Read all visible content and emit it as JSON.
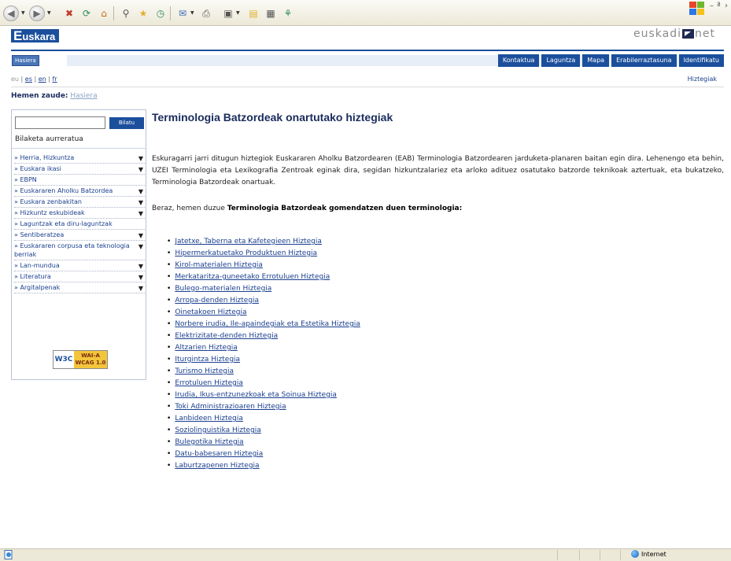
{
  "browser": {
    "toolbar_icons": [
      "back-icon",
      "forward-icon",
      "stop-icon",
      "refresh-icon",
      "home-icon",
      "search-icon",
      "favorites-icon",
      "history-icon",
      "mail-icon",
      "print-icon",
      "edit-icon",
      "discuss-icon",
      "folder-icon",
      "research-icon",
      "messenger-icon"
    ],
    "status_zone": "Internet"
  },
  "header": {
    "logo_initial": "E",
    "logo_text": "uskara",
    "brand_left": "euskadi",
    "brand_right": "net"
  },
  "nav": {
    "home_label": "Hasiera",
    "items": [
      "Kontaktua",
      "Laguntza",
      "Mapa",
      "Erabilerraztasuna",
      "Identifikatu"
    ]
  },
  "lang": {
    "items": [
      "eu",
      "es",
      "en",
      "fr"
    ],
    "separator": "|"
  },
  "hiztegiak_link": "Hiztegiak",
  "breadcrumb": {
    "label": "Hemen zaude:",
    "current": "Hasiera"
  },
  "sidebar": {
    "search_value": "",
    "search_button": "Bilatu",
    "advanced_search": "Bilaketa aurreratua",
    "items": [
      {
        "label": "» Herria, Hizkuntza",
        "has_arrow": true
      },
      {
        "label": "» Euskara ikasi",
        "has_arrow": true
      },
      {
        "label": "» EBPN",
        "has_arrow": false
      },
      {
        "label": "» Euskararen Aholku Batzordea",
        "has_arrow": true
      },
      {
        "label": "» Euskara zenbakitan",
        "has_arrow": true
      },
      {
        "label": "» Hizkuntz eskubideak",
        "has_arrow": true
      },
      {
        "label": "» Laguntzak eta diru-laguntzak",
        "has_arrow": false
      },
      {
        "label": "» Sentiberatzea",
        "has_arrow": true
      },
      {
        "label": "» Euskararen corpusa eta teknologia berriak",
        "has_arrow": true
      },
      {
        "label": "» Lan-mundua",
        "has_arrow": true
      },
      {
        "label": "» Literatura",
        "has_arrow": true
      },
      {
        "label": "» Argitalpenak",
        "has_arrow": true
      }
    ],
    "badge_left": "W3C",
    "badge_right_1": "WAI-A",
    "badge_right_2": "WCAG 1.0"
  },
  "main": {
    "title": "Terminologia Batzordeak onartutako hiztegiak",
    "intro": "Eskuragarri jarri ditugun hiztegiok Euskararen Aholku Batzordearen (EAB) Terminologia Batzordearen jarduketa-planaren baitan egin dira. Lehenengo eta behin, UZEI Terminologia eta Lexikografia Zentroak eginak dira, segidan hizkuntzalariez eta arloko adituez osatutako batzorde teknikoak aztertuak, eta bukatzeko, Terminologia Batzordeak onartuak.",
    "lead_prefix": "Beraz, hemen duzue",
    "lead_bold": "Terminologia Batzordeak gomendatzen duen terminologia:",
    "glossaries": [
      "Jatetxe, Taberna eta Kafetegieen Hiztegia",
      "Hipermerkatuetako Produktuen Hiztegia",
      "Kirol-materialen Hiztegia",
      "Merkataritza-guneetako Errotuluen Hiztegia",
      "Bulego-materialen Hiztegia",
      "Arropa-denden Hiztegia",
      "Oinetakoen Hiztegia",
      "Norbere irudia, Ile-apaindegiak eta Estetika Hiztegia",
      "Elektrizitate-denden Hiztegia",
      "Altzarien Hiztegia",
      "Iturgintza Hiztegia",
      "Turismo Hiztegia",
      "Errotuluen Hiztegia",
      "Irudia, Ikus-entzunezkoak eta Soinua Hiztegia",
      "Toki Administrazioaren Hiztegia",
      "Lanbideen Hiztegia",
      "Soziolinguistika Hiztegia",
      "Bulegotika Hiztegia",
      "Datu-babesaren Hiztegia",
      "Laburtzapenen Hiztegia"
    ]
  },
  "colors": {
    "brand_blue": "#1b4f9c",
    "link": "#1a3f8f",
    "title": "#1a2c5c"
  }
}
